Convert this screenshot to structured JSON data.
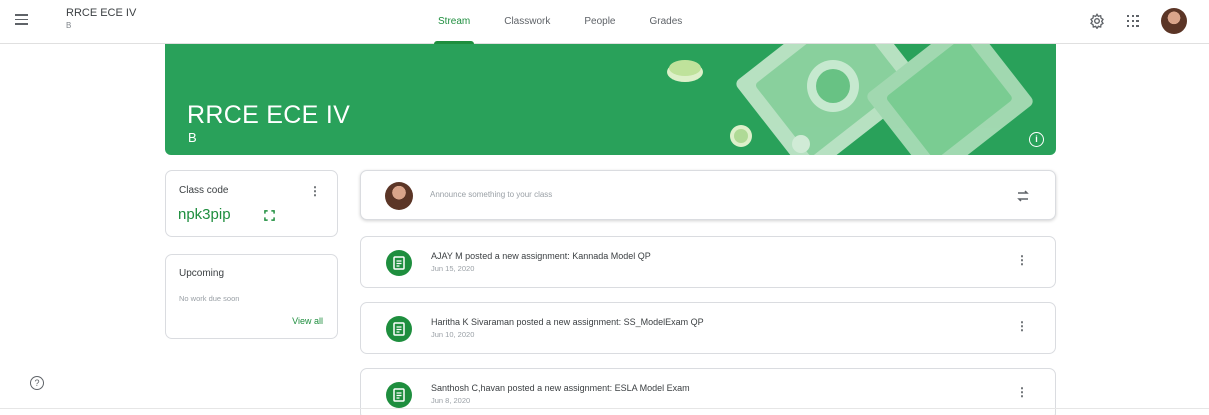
{
  "header": {
    "class_title": "RRCE ECE IV",
    "class_section": "B",
    "tabs": [
      {
        "label": "Stream",
        "active": true
      },
      {
        "label": "Classwork",
        "active": false
      },
      {
        "label": "People",
        "active": false
      },
      {
        "label": "Grades",
        "active": false
      }
    ],
    "icons": [
      "menu-icon",
      "gear-icon",
      "apps-grid-icon",
      "avatar"
    ]
  },
  "banner": {
    "title": "RRCE ECE IV",
    "section": "B",
    "color": "#29a15a",
    "info_icon": "i"
  },
  "class_code": {
    "label": "Class code",
    "value": "npk3pip",
    "more_icon": "⋮"
  },
  "upcoming": {
    "title": "Upcoming",
    "empty_text": "No work due soon",
    "view_all": "View all"
  },
  "announce": {
    "placeholder": "Announce something to your class"
  },
  "posts": [
    {
      "title": "AJAY M posted a new assignment: Kannada Model QP",
      "date": "Jun 15, 2020",
      "more_icon": "⋮"
    },
    {
      "title": "Haritha K Sivaraman posted a new assignment: SS_ModelExam QP",
      "date": "Jun 10, 2020",
      "more_icon": "⋮"
    },
    {
      "title": "Santhosh C,havan posted a new assignment: ESLA Model Exam",
      "date": "Jun 8, 2020",
      "more_icon": "⋮"
    }
  ],
  "help_icon": "?",
  "accent_color": "#1e8e3e"
}
